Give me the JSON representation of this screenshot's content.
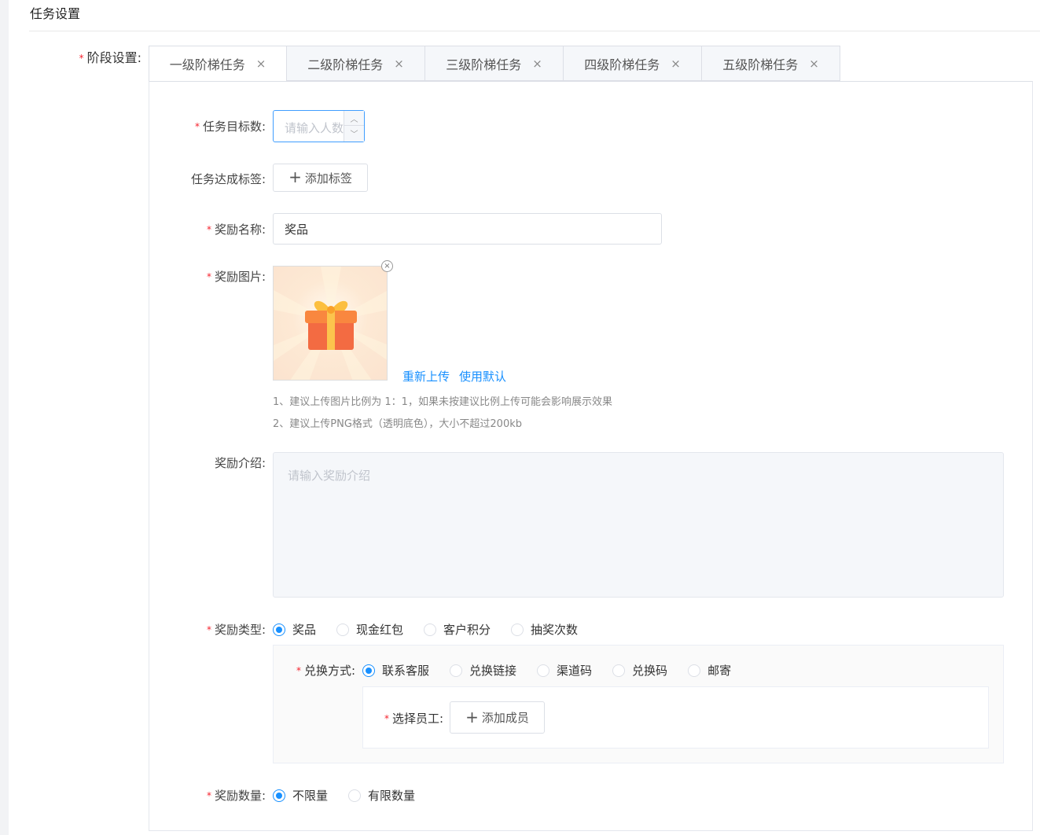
{
  "section": {
    "title": "任务设置"
  },
  "stage": {
    "label": "阶段设置:",
    "tabs": [
      {
        "label": "一级阶梯任务"
      },
      {
        "label": "二级阶梯任务"
      },
      {
        "label": "三级阶梯任务"
      },
      {
        "label": "四级阶梯任务"
      },
      {
        "label": "五级阶梯任务"
      }
    ],
    "close_glyph": "×"
  },
  "form": {
    "target": {
      "label": "任务目标数:",
      "placeholder": "请输入人数"
    },
    "tag": {
      "label": "任务达成标签:",
      "button": "添加标签"
    },
    "reward_name": {
      "label": "奖励名称:",
      "value": "奖品"
    },
    "reward_image": {
      "label": "奖励图片:",
      "reupload": "重新上传",
      "use_default": "使用默认",
      "tips": [
        "1、建议上传图片比例为 1：1，如果未按建议比例上传可能会影响展示效果",
        "2、建议上传PNG格式（透明底色），大小不超过200kb"
      ]
    },
    "reward_intro": {
      "label": "奖励介绍:",
      "placeholder": "请输入奖励介绍"
    },
    "reward_type": {
      "label": "奖励类型:",
      "options": [
        "奖品",
        "现金红包",
        "客户积分",
        "抽奖次数"
      ],
      "selected": "奖品"
    },
    "redeem": {
      "label": "兑换方式:",
      "options": [
        "联系客服",
        "兑换链接",
        "渠道码",
        "兑换码",
        "邮寄"
      ],
      "selected": "联系客服"
    },
    "staff": {
      "label": "选择员工:",
      "button": "添加成员"
    },
    "reward_quantity": {
      "label": "奖励数量:",
      "options": [
        "不限量",
        "有限数量"
      ],
      "selected": "不限量"
    }
  },
  "colors": {
    "primary": "#1890ff",
    "required": "#f5222d",
    "border": "#dcdfe6"
  },
  "icons": {
    "plus": "+",
    "close": "×",
    "gift": "gift-image"
  }
}
